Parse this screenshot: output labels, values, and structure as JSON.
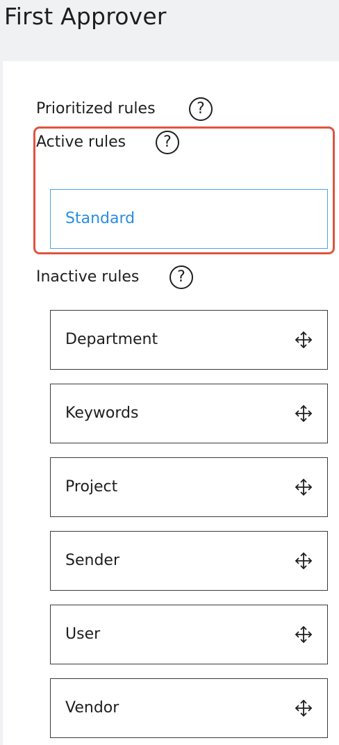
{
  "page": {
    "title": "First Approver"
  },
  "prioritized": {
    "label": "Prioritized rules",
    "help_icon": "question-circle-icon",
    "help_glyph": "?"
  },
  "active": {
    "label": "Active rules",
    "help_icon": "question-circle-icon",
    "help_glyph": "?",
    "rules": [
      "Standard"
    ]
  },
  "inactive": {
    "label": "Inactive rules",
    "help_icon": "question-circle-icon",
    "help_glyph": "?",
    "drag_icon": "move-arrows-icon",
    "rules": [
      "Department",
      "Keywords",
      "Project",
      "Sender",
      "User",
      "Vendor"
    ]
  },
  "colors": {
    "highlight_border": "#e0533f",
    "active_rule_text": "#2a8de0",
    "active_rule_border": "#4aa3e6"
  }
}
